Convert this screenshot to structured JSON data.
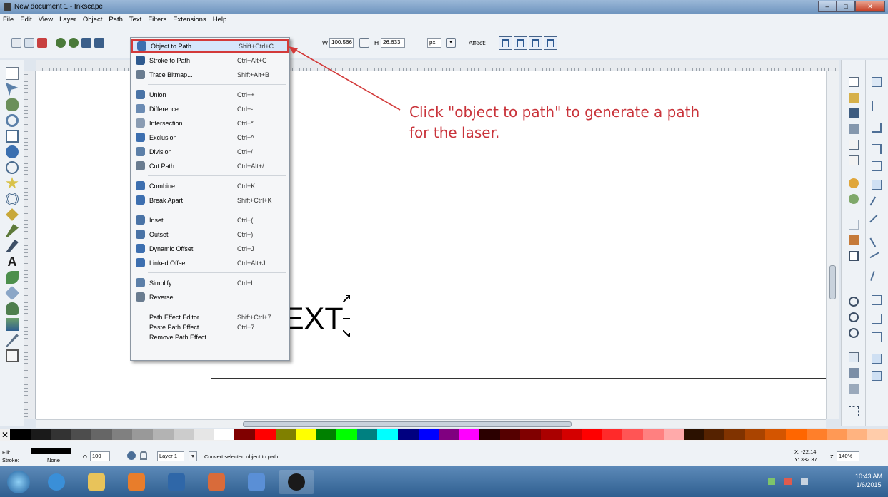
{
  "window": {
    "title": "New document 1 - Inkscape"
  },
  "menubar": [
    "File",
    "Edit",
    "View",
    "Layer",
    "Object",
    "Path",
    "Text",
    "Filters",
    "Extensions",
    "Help"
  ],
  "toolbar": {
    "w_label": "W",
    "w_value": "100.566",
    "h_label": "H",
    "h_value": "26.633",
    "units": "px",
    "affect_label": "Affect:"
  },
  "path_menu": {
    "items": [
      {
        "label": "Object to Path",
        "shortcut": "Shift+Ctrl+C",
        "icon": "object-to-path-icon"
      },
      {
        "label": "Stroke to Path",
        "shortcut": "Ctrl+Alt+C",
        "icon": "stroke-to-path-icon"
      },
      {
        "label": "Trace Bitmap...",
        "shortcut": "Shift+Alt+B",
        "icon": "trace-bitmap-icon"
      },
      {
        "label": "Union",
        "shortcut": "Ctrl++",
        "icon": "union-icon"
      },
      {
        "label": "Difference",
        "shortcut": "Ctrl+-",
        "icon": "difference-icon"
      },
      {
        "label": "Intersection",
        "shortcut": "Ctrl+*",
        "icon": "intersection-icon"
      },
      {
        "label": "Exclusion",
        "shortcut": "Ctrl+^",
        "icon": "exclusion-icon"
      },
      {
        "label": "Division",
        "shortcut": "Ctrl+/",
        "icon": "division-icon"
      },
      {
        "label": "Cut Path",
        "shortcut": "Ctrl+Alt+/",
        "icon": "cut-path-icon"
      },
      {
        "label": "Combine",
        "shortcut": "Ctrl+K",
        "icon": "combine-icon"
      },
      {
        "label": "Break Apart",
        "shortcut": "Shift+Ctrl+K",
        "icon": "break-apart-icon"
      },
      {
        "label": "Inset",
        "shortcut": "Ctrl+(",
        "icon": "inset-icon"
      },
      {
        "label": "Outset",
        "shortcut": "Ctrl+)",
        "icon": "outset-icon"
      },
      {
        "label": "Dynamic Offset",
        "shortcut": "Ctrl+J",
        "icon": "dynamic-offset-icon"
      },
      {
        "label": "Linked Offset",
        "shortcut": "Ctrl+Alt+J",
        "icon": "linked-offset-icon"
      },
      {
        "label": "Simplify",
        "shortcut": "Ctrl+L",
        "icon": "simplify-icon"
      },
      {
        "label": "Reverse",
        "shortcut": "",
        "icon": "reverse-icon"
      },
      {
        "label": "Path Effect Editor...",
        "shortcut": "Shift+Ctrl+7",
        "icon": ""
      },
      {
        "label": "Paste Path Effect",
        "shortcut": "Ctrl+7",
        "icon": ""
      },
      {
        "label": "Remove Path Effect",
        "shortcut": "",
        "icon": ""
      }
    ]
  },
  "callout": {
    "line1": "Click \"object to path\" to generate a path",
    "line2": "for the laser.",
    "color": "#c9333a"
  },
  "canvas": {
    "text_fragment": "EXT"
  },
  "status": {
    "fill_label": "Fill:",
    "stroke_label": "Stroke:",
    "stroke_value": "None",
    "opacity_label": "O:",
    "opacity_value": "100",
    "layer_value": "Layer 1",
    "message": "Convert selected object to path",
    "x_coord": "X: -22.14",
    "y_coord": "Y: 332.37",
    "zoom_label": "Z:",
    "zoom_value": "140%"
  },
  "taskbar": {
    "time": "10:43 AM",
    "date": "1/6/2015"
  },
  "palette_colors": [
    "#000000",
    "#1a1a1a",
    "#333333",
    "#4d4d4d",
    "#666666",
    "#808080",
    "#999999",
    "#b3b3b3",
    "#cccccc",
    "#e6e6e6",
    "#ffffff",
    "#800000",
    "#ff0000",
    "#808000",
    "#ffff00",
    "#008000",
    "#00ff00",
    "#008080",
    "#00ffff",
    "#000080",
    "#0000ff",
    "#800080",
    "#ff00ff",
    "#2b0000",
    "#550000",
    "#800000",
    "#aa0000",
    "#d40000",
    "#ff0000",
    "#ff2a2a",
    "#ff5555",
    "#ff8080",
    "#ffaaaa",
    "#2b1100",
    "#552200",
    "#803300",
    "#aa4400",
    "#d45500",
    "#ff6600",
    "#ff7f2a",
    "#ff9955",
    "#ffb380",
    "#ffccaa"
  ]
}
